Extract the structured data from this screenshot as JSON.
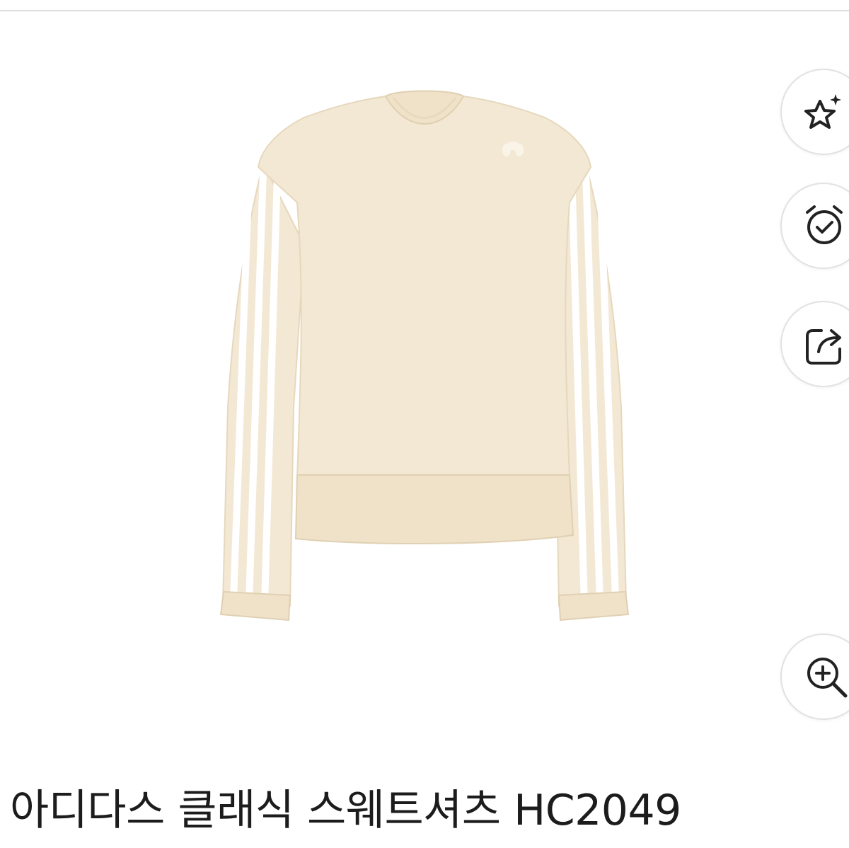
{
  "product": {
    "title": "아디다스 클래식 스웨트셔츠 HC2049",
    "garment_color": "#f3e8d4",
    "stripe_color": "#ffffff"
  },
  "actions": [
    {
      "name": "wishlist",
      "icon": "star-sparkle-icon"
    },
    {
      "name": "alarm",
      "icon": "alarm-check-icon"
    },
    {
      "name": "share",
      "icon": "share-icon"
    },
    {
      "name": "zoom",
      "icon": "zoom-in-icon"
    }
  ]
}
